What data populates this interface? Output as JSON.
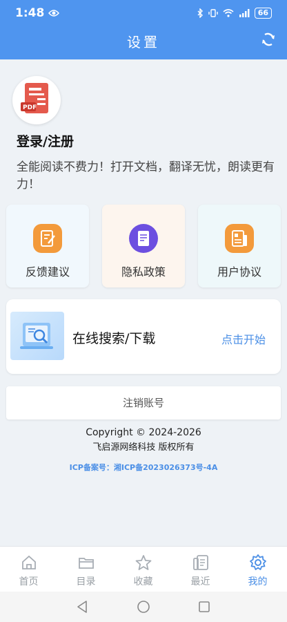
{
  "status_bar": {
    "time": "1:48",
    "battery": "66"
  },
  "header": {
    "title": "设置"
  },
  "profile": {
    "login_label": "登录/注册",
    "slogan": "全能阅读不费力！打开文档，翻译无忧，朗读更有力！"
  },
  "cards": [
    {
      "label": "反馈建议"
    },
    {
      "label": "隐私政策"
    },
    {
      "label": "用户协议"
    }
  ],
  "search_card": {
    "title": "在线搜索/下载",
    "action": "点击开始"
  },
  "logout": {
    "label": "注销账号"
  },
  "footer": {
    "copyright": "Copyright © 2024-2026",
    "company": "飞启源网络科技  版权所有",
    "icp": "ICP备案号：湘ICP备2023026373号-4A"
  },
  "tabbar": [
    {
      "label": "首页",
      "icon": "home-icon"
    },
    {
      "label": "目录",
      "icon": "folder-icon"
    },
    {
      "label": "收藏",
      "icon": "star-icon"
    },
    {
      "label": "最近",
      "icon": "recent-icon"
    },
    {
      "label": "我的",
      "icon": "gear-icon",
      "active": true
    }
  ],
  "colors": {
    "accent": "#4f95ef",
    "link": "#4b8fe6",
    "background": "#eef2f6"
  }
}
